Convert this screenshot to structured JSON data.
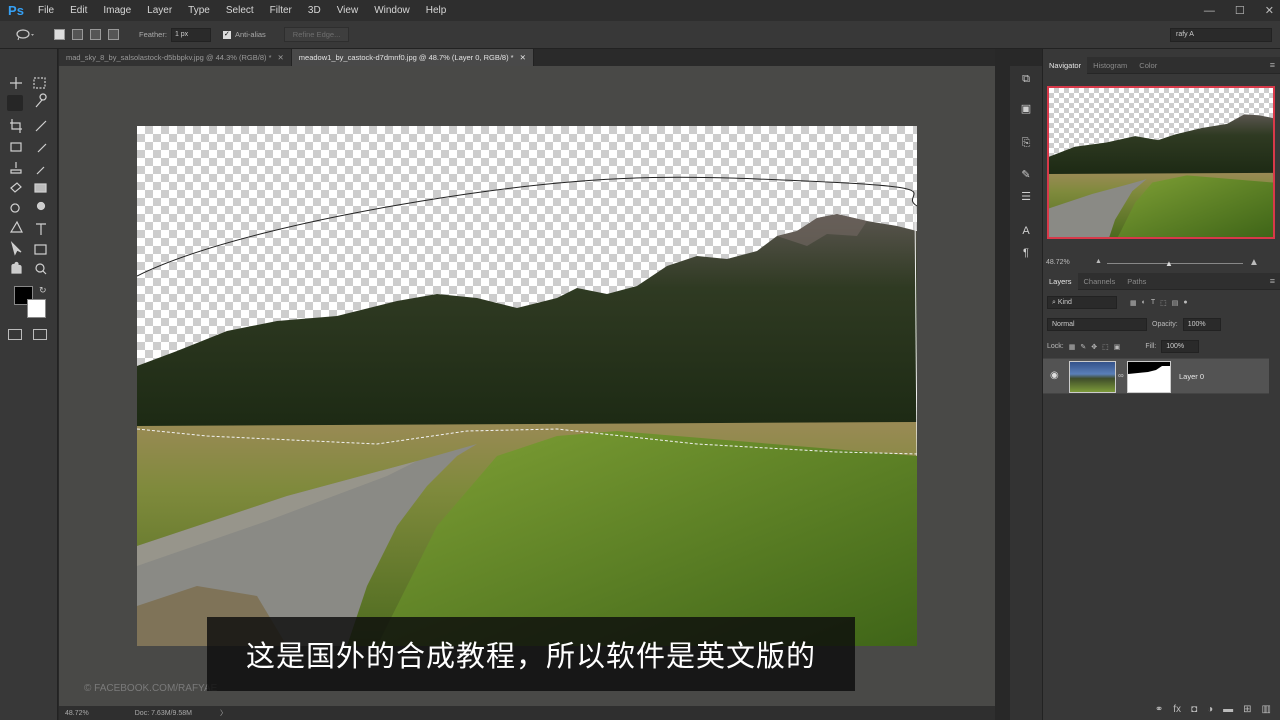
{
  "app": {
    "logo": "Ps"
  },
  "menu": [
    "File",
    "Edit",
    "Image",
    "Layer",
    "Type",
    "Select",
    "Filter",
    "3D",
    "View",
    "Window",
    "Help"
  ],
  "window_controls": [
    "—",
    "☐",
    "✕"
  ],
  "options_bar": {
    "feather_label": "Feather:",
    "feather_value": "1 px",
    "antialias_label": "Anti-alias",
    "refine_edge": "Refine Edge...",
    "workspace": "rafy A"
  },
  "tabs": [
    {
      "label": "mad_sky_8_by_salsolastock-d5bbpkv.jpg @ 44.3% (RGB/8) *",
      "close": "✕"
    },
    {
      "label": "meadow1_by_castock-d7dmnf0.jpg @ 48.7% (Layer 0, RGB/8) *",
      "close": "✕"
    }
  ],
  "watermark": "© FACEBOOK.COM/RAFYAE",
  "subtitle": "这是国外的合成教程，所以软件是英文版的",
  "status": {
    "zoom": "48.72%",
    "doc": "Doc: 7.63M/9.58M",
    "arrow": "〉"
  },
  "navigator": {
    "tabs": [
      "Navigator",
      "Histogram",
      "Color"
    ],
    "zoom": "48.72%"
  },
  "layers": {
    "tabs": [
      "Layers",
      "Channels",
      "Paths"
    ],
    "filter_kind": "Kind",
    "blend_mode": "Normal",
    "opacity_label": "Opacity:",
    "opacity_value": "100%",
    "lock_label": "Lock:",
    "fill_label": "Fill:",
    "fill_value": "100%",
    "items": [
      {
        "name": "Layer 0",
        "visible": true
      }
    ]
  },
  "colors": {
    "accent": "#35a0f5",
    "nav_frame": "#d8394a",
    "canvas_bg": "#494947"
  },
  "icons": {
    "tools": [
      "move-icon",
      "marquee-icon",
      "lasso-icon",
      "quick-select-icon",
      "crop-icon",
      "eyedropper-icon",
      "healing-icon",
      "brush-icon",
      "stamp-icon",
      "history-brush-icon",
      "eraser-icon",
      "gradient-icon",
      "blur-icon",
      "dodge-icon",
      "pen-icon",
      "type-icon",
      "path-select-icon",
      "shape-icon",
      "hand-icon",
      "zoom-icon"
    ]
  }
}
